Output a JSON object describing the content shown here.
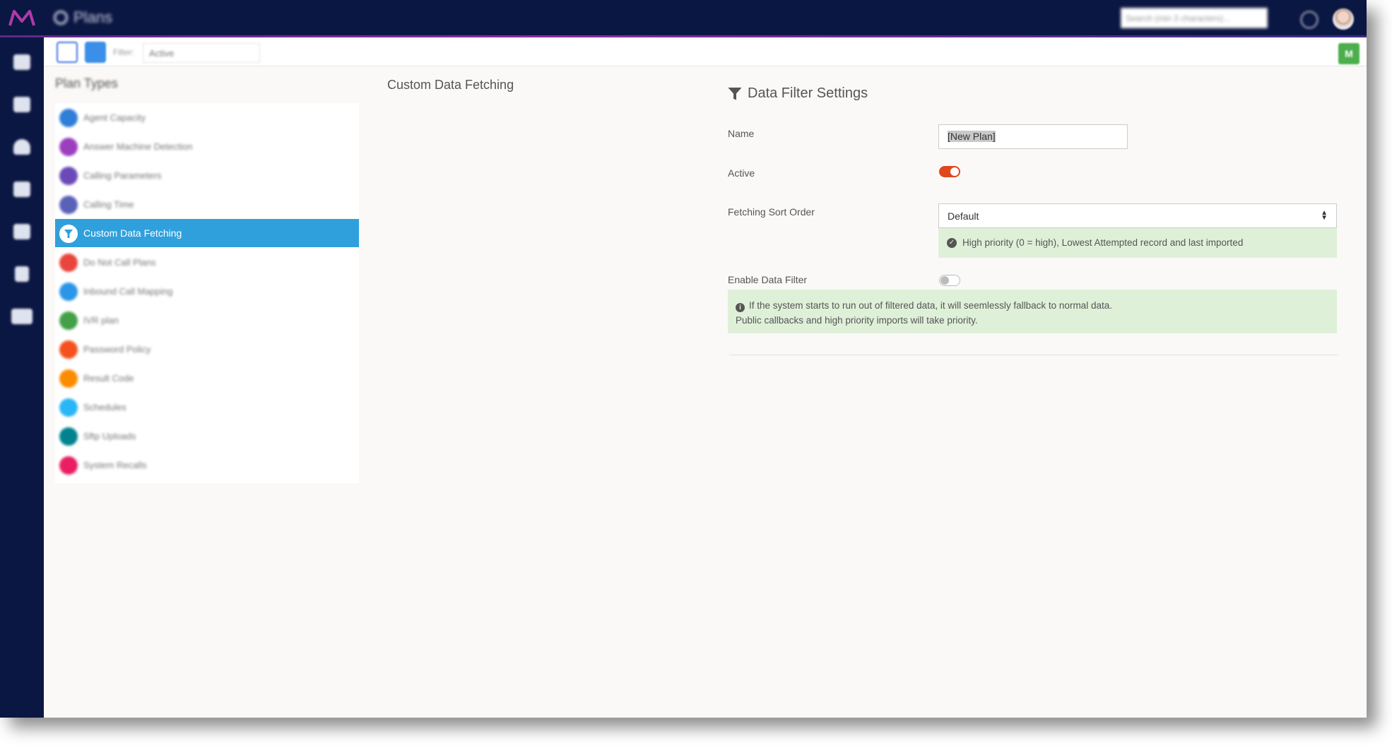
{
  "app": {
    "title": "Plans",
    "search_placeholder": "Search (min 3 characters)..."
  },
  "toolbar": {
    "filter_label": "Filter:",
    "filter_value": "Active",
    "user_badge": "M"
  },
  "plan_types": {
    "title": "Plan Types",
    "items": [
      {
        "label": "Agent Capacity",
        "color": "#2f7ed8"
      },
      {
        "label": "Answer Machine Detection",
        "color": "#9c3fbf"
      },
      {
        "label": "Calling Parameters",
        "color": "#6a4ab8"
      },
      {
        "label": "Calling Time",
        "color": "#5a62b8"
      },
      {
        "label": "Custom Data Fetching",
        "color": "#30a0dc"
      },
      {
        "label": "Do Not Call Plans",
        "color": "#e8453c"
      },
      {
        "label": "Inbound Call Mapping",
        "color": "#2a96e8"
      },
      {
        "label": "IVR plan",
        "color": "#43a047"
      },
      {
        "label": "Password Policy",
        "color": "#f4511e"
      },
      {
        "label": "Result Code",
        "color": "#fb8c00"
      },
      {
        "label": "Schedules",
        "color": "#29b6f6"
      },
      {
        "label": "Sftp Uploads",
        "color": "#00838f"
      },
      {
        "label": "System Recalls",
        "color": "#e91e63"
      }
    ]
  },
  "middle": {
    "title": "Custom Data Fetching"
  },
  "settings": {
    "title": "Data Filter Settings",
    "name_label": "Name",
    "name_value": "[New Plan]",
    "active_label": "Active",
    "active": true,
    "sort_label": "Fetching Sort Order",
    "sort_value": "Default",
    "sort_note": "High priority (0 = high), Lowest Attempted record and last imported",
    "enable_filter_label": "Enable Data Filter",
    "enable_filter": false,
    "filter_note_line1": "If the system starts to run out of filtered data, it will seemlessly fallback to normal data.",
    "filter_note_line2": "Public callbacks and high priority imports will take priority."
  },
  "colors": {
    "topbar": "#0b1743",
    "active_item": "#30a0dc",
    "toggle_on": "#e0471b",
    "note_bg": "#dff0d8"
  }
}
